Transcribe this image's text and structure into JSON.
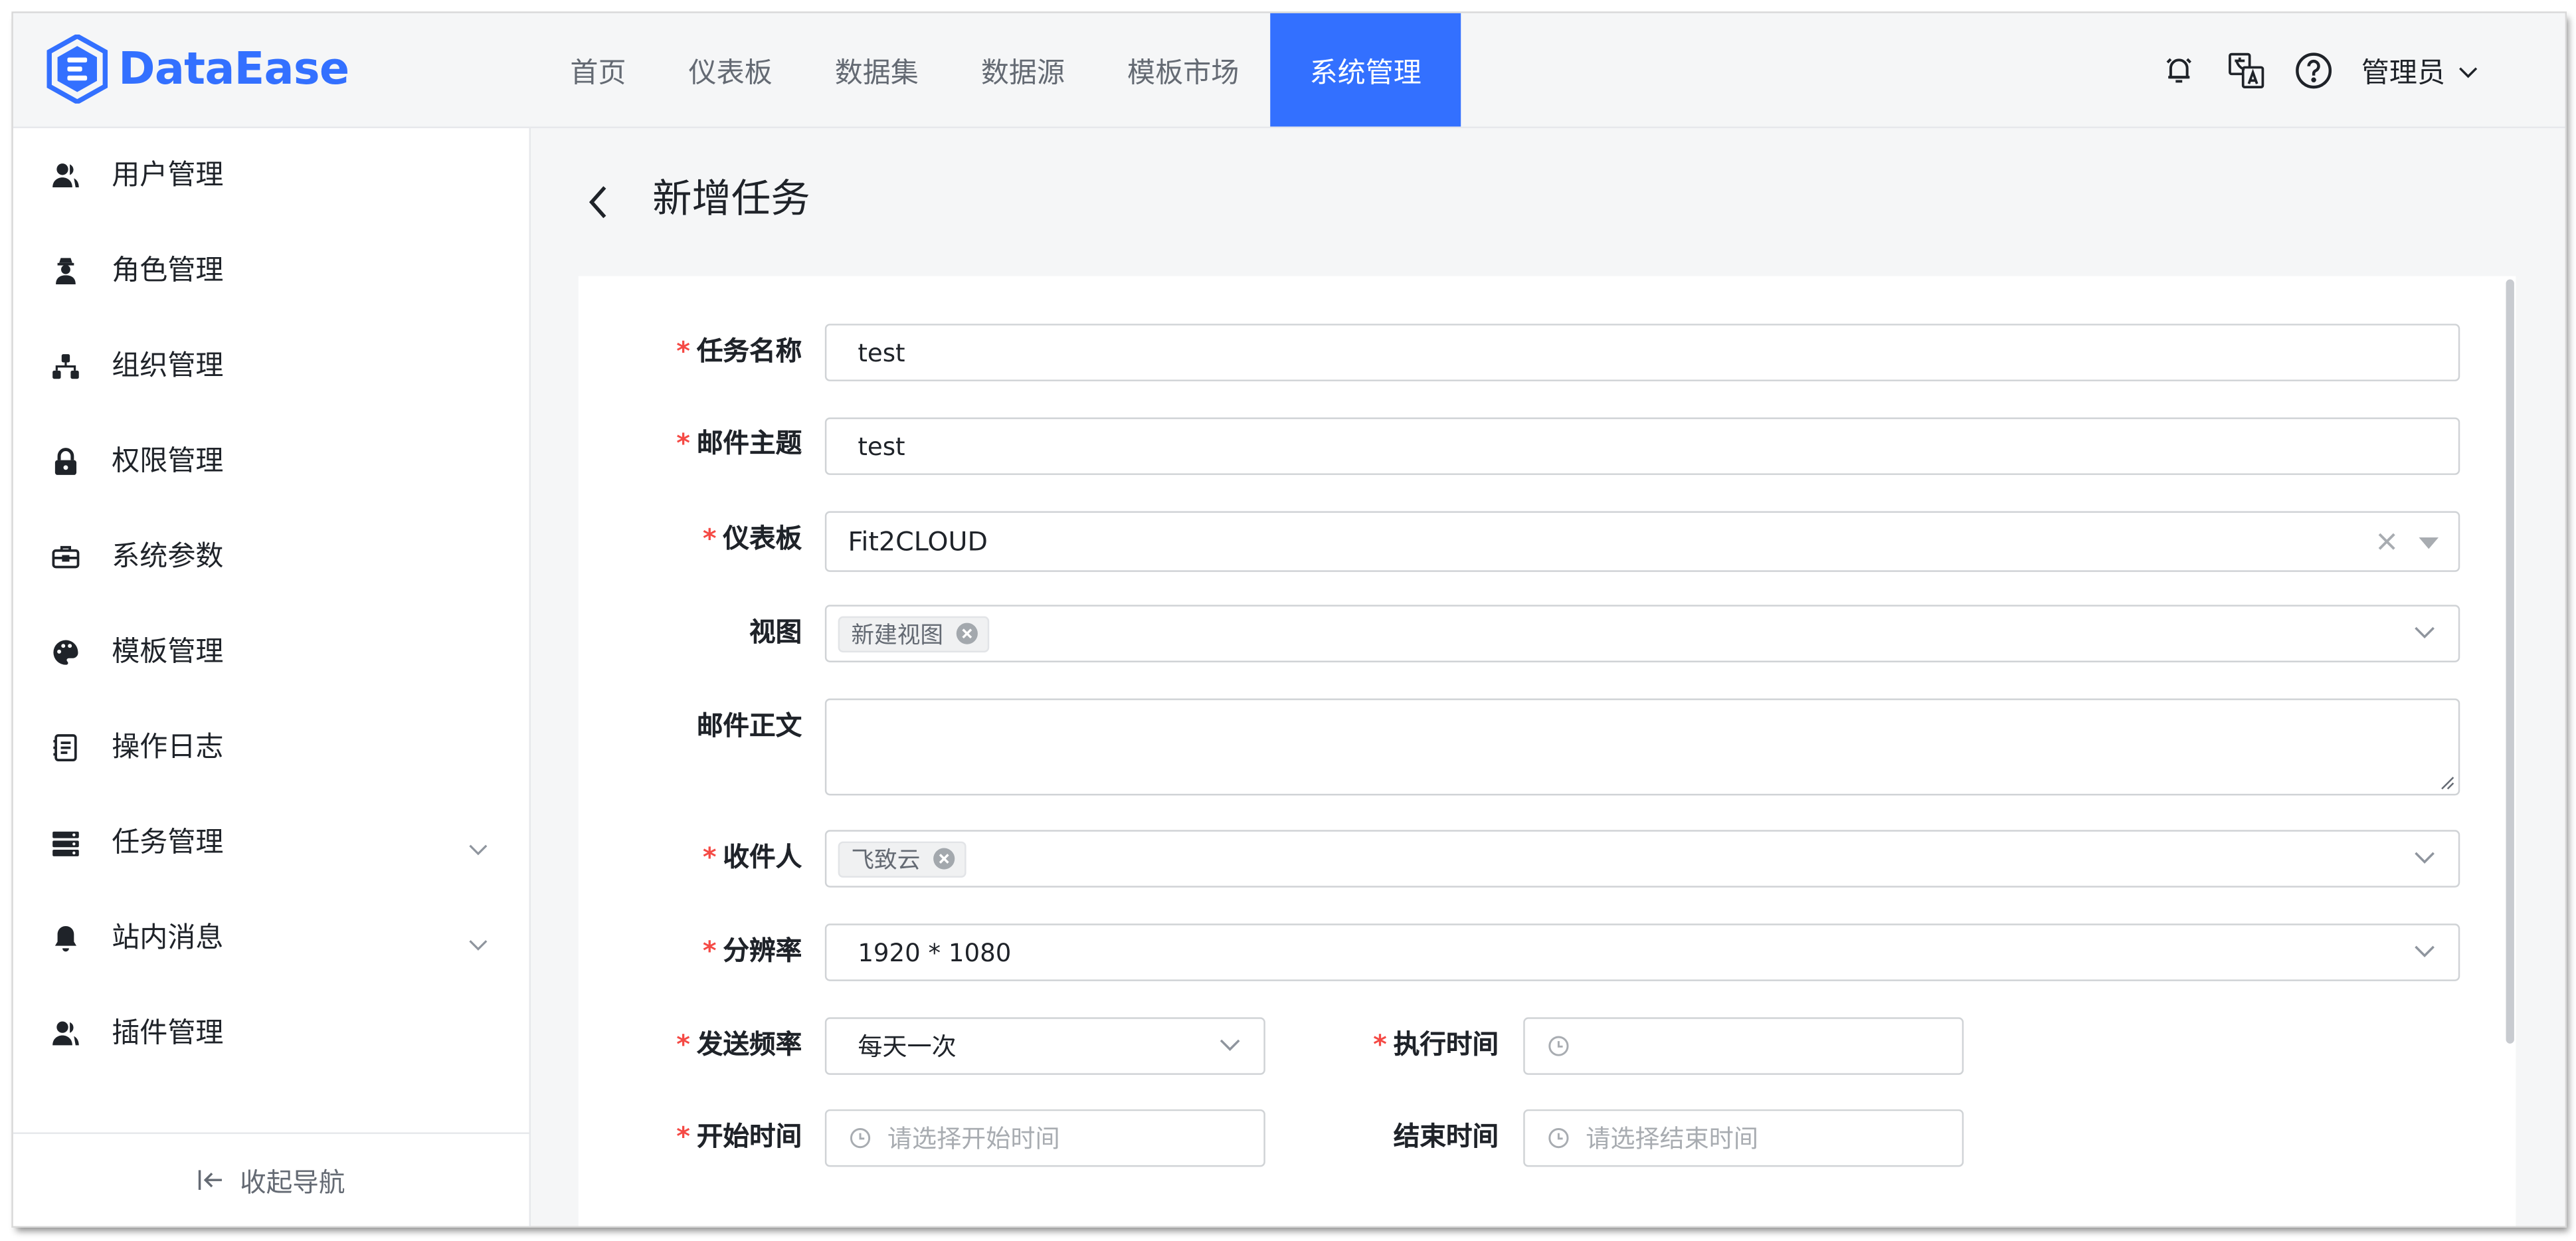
{
  "app": {
    "logo_text": "DataEase",
    "accent_color": "#3370ff"
  },
  "topnav": [
    {
      "label": "首页"
    },
    {
      "label": "仪表板"
    },
    {
      "label": "数据集"
    },
    {
      "label": "数据源"
    },
    {
      "label": "模板市场"
    },
    {
      "label": "系统管理",
      "active": true
    }
  ],
  "header": {
    "icons": [
      "bell-icon",
      "translate-icon",
      "help-icon"
    ],
    "user_label": "管理员"
  },
  "sidebar": {
    "items": [
      {
        "label": "用户管理",
        "icon": "user-icon"
      },
      {
        "label": "角色管理",
        "icon": "role-icon"
      },
      {
        "label": "组织管理",
        "icon": "org-icon"
      },
      {
        "label": "权限管理",
        "icon": "lock-icon"
      },
      {
        "label": "系统参数",
        "icon": "toolbox-icon"
      },
      {
        "label": "模板管理",
        "icon": "palette-icon"
      },
      {
        "label": "操作日志",
        "icon": "log-icon"
      },
      {
        "label": "任务管理",
        "icon": "server-icon",
        "expandable": true
      },
      {
        "label": "站内消息",
        "icon": "bell-icon",
        "expandable": true
      },
      {
        "label": "插件管理",
        "icon": "plugin-icon"
      }
    ],
    "collapse_label": "收起导航"
  },
  "page": {
    "title": "新增任务"
  },
  "form": {
    "task_name": {
      "label": "任务名称",
      "required": true,
      "value": "test"
    },
    "mail_subject": {
      "label": "邮件主题",
      "required": true,
      "value": "test"
    },
    "dashboard": {
      "label": "仪表板",
      "required": true,
      "value": "Fit2CLOUD"
    },
    "view": {
      "label": "视图",
      "required": false,
      "tags": [
        "新建视图"
      ]
    },
    "mail_body": {
      "label": "邮件正文",
      "required": false,
      "value": ""
    },
    "recipients": {
      "label": "收件人",
      "required": true,
      "tags": [
        "飞致云"
      ]
    },
    "resolution": {
      "label": "分辨率",
      "required": true,
      "value": "1920 * 1080"
    },
    "frequency": {
      "label": "发送频率",
      "required": true,
      "value": "每天一次"
    },
    "exec_time": {
      "label": "执行时间",
      "required": true,
      "value": ""
    },
    "start_time": {
      "label": "开始时间",
      "required": true,
      "placeholder": "请选择开始时间"
    },
    "end_time": {
      "label": "结束时间",
      "required": false,
      "placeholder": "请选择结束时间"
    }
  }
}
